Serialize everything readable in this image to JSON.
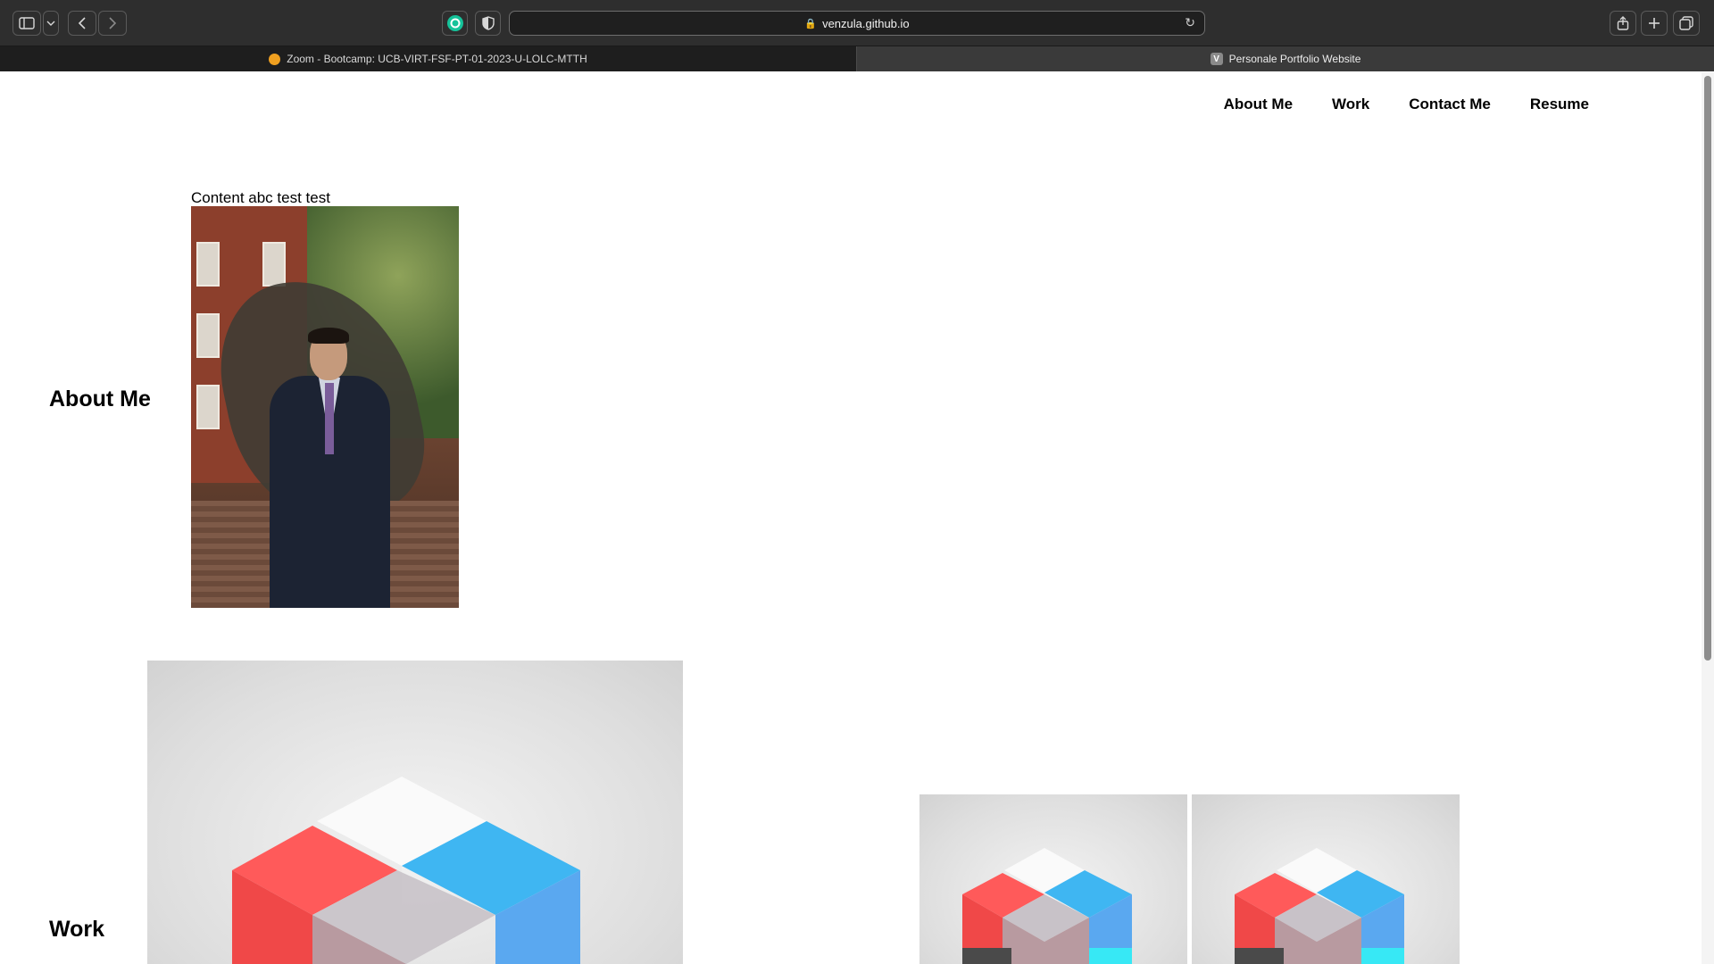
{
  "browser": {
    "url": "venzula.github.io",
    "tabs": [
      {
        "label": "Zoom - Bootcamp: UCB-VIRT-FSF-PT-01-2023-U-LOLC-MTTH",
        "favicon": "zoom-icon",
        "active": false
      },
      {
        "label": "Personale Portfolio Website",
        "favicon": "v-icon",
        "favicon_letter": "V",
        "active": true
      }
    ],
    "toolbar_icons": [
      "sidebar-icon",
      "chevron-down-icon",
      "back-icon",
      "forward-icon",
      "grammarly-icon",
      "privacy-shield-icon",
      "lock-icon",
      "reload-icon",
      "share-icon",
      "new-tab-icon",
      "tab-overview-icon"
    ]
  },
  "nav": {
    "items": [
      "About Me",
      "Work",
      "Contact Me",
      "Resume"
    ]
  },
  "about": {
    "heading": "About Me",
    "content": "Content abc test test"
  },
  "work": {
    "heading": "Work"
  },
  "colors": {
    "toolbar_bg": "#2e2e2e",
    "tab_inactive_bg": "#1e1e1e",
    "tab_active_bg": "#3a3a3a",
    "grammarly_green": "#15c39a",
    "cube_red": "#ff4f4f",
    "cube_blue": "#3fb6f2",
    "cube_cyan": "#37e8f5"
  }
}
